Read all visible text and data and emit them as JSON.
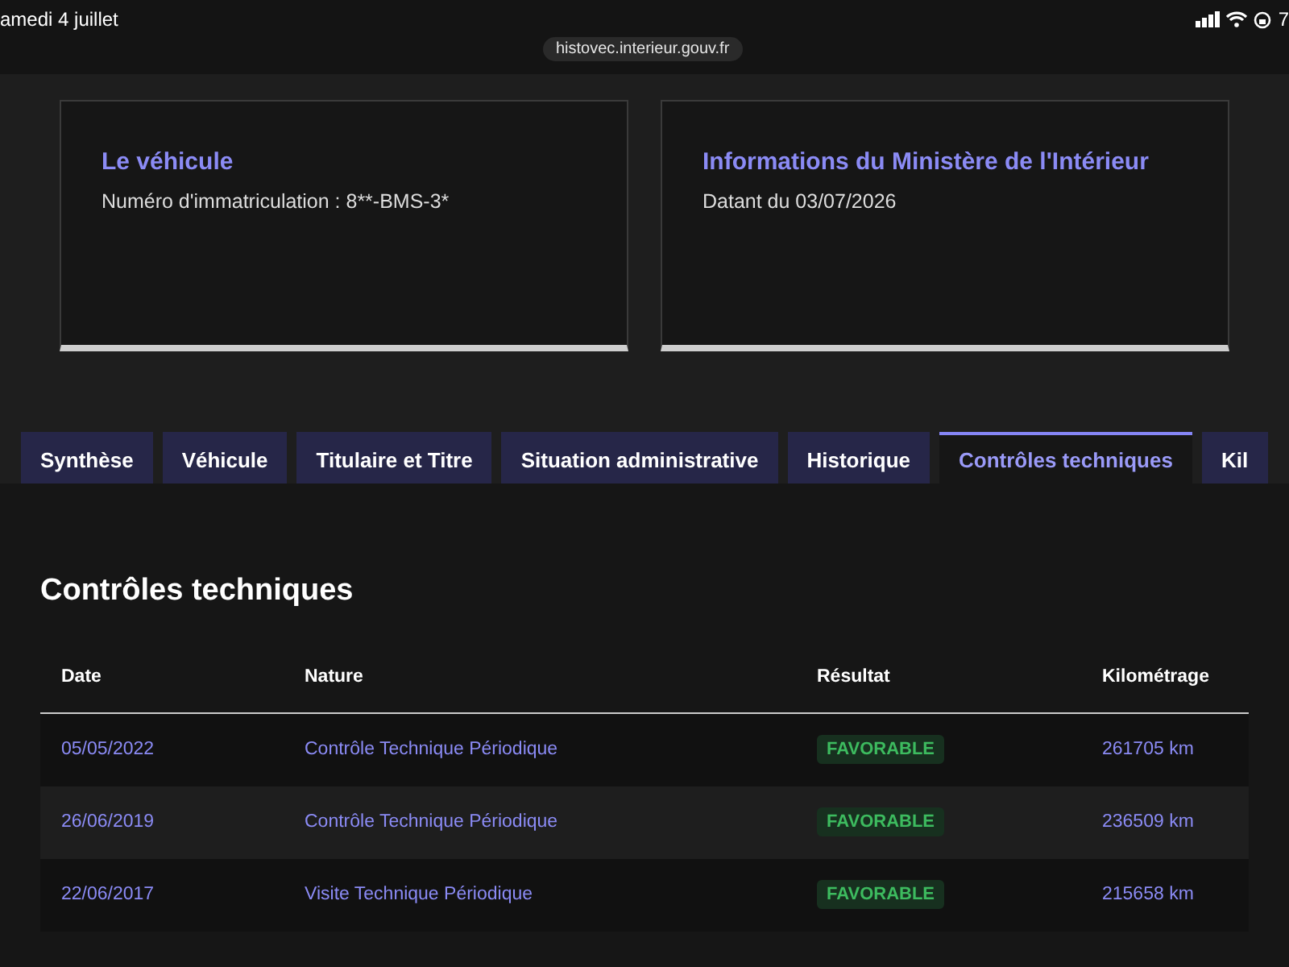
{
  "status_bar": {
    "date": "amedi 4 juillet",
    "battery": "7"
  },
  "address_bar": {
    "url": "histovec.interieur.gouv.fr"
  },
  "cards": [
    {
      "title": "Le véhicule",
      "text": "Numéro d'immatriculation : 8**-BMS-3*"
    },
    {
      "title": "Informations du Ministère de l'Intérieur",
      "text": "Datant du 03/07/2026"
    }
  ],
  "tabs": [
    {
      "label": "Synthèse",
      "selected": false
    },
    {
      "label": "Véhicule",
      "selected": false
    },
    {
      "label": "Titulaire et Titre",
      "selected": false
    },
    {
      "label": "Situation administrative",
      "selected": false
    },
    {
      "label": "Historique",
      "selected": false
    },
    {
      "label": "Contrôles techniques",
      "selected": true
    },
    {
      "label": "Kil",
      "selected": false
    }
  ],
  "section": {
    "title": "Contrôles techniques"
  },
  "table": {
    "columns": [
      "Date",
      "Nature",
      "Résultat",
      "Kilométrage"
    ],
    "rows": [
      [
        "05/05/2022",
        "Contrôle Technique Périodique",
        "FAVORABLE",
        "261705 km"
      ],
      [
        "26/06/2019",
        "Contrôle Technique Périodique",
        "FAVORABLE",
        "236509 km"
      ],
      [
        "22/06/2017",
        "Visite Technique Périodique",
        "FAVORABLE",
        "215658 km"
      ]
    ]
  }
}
